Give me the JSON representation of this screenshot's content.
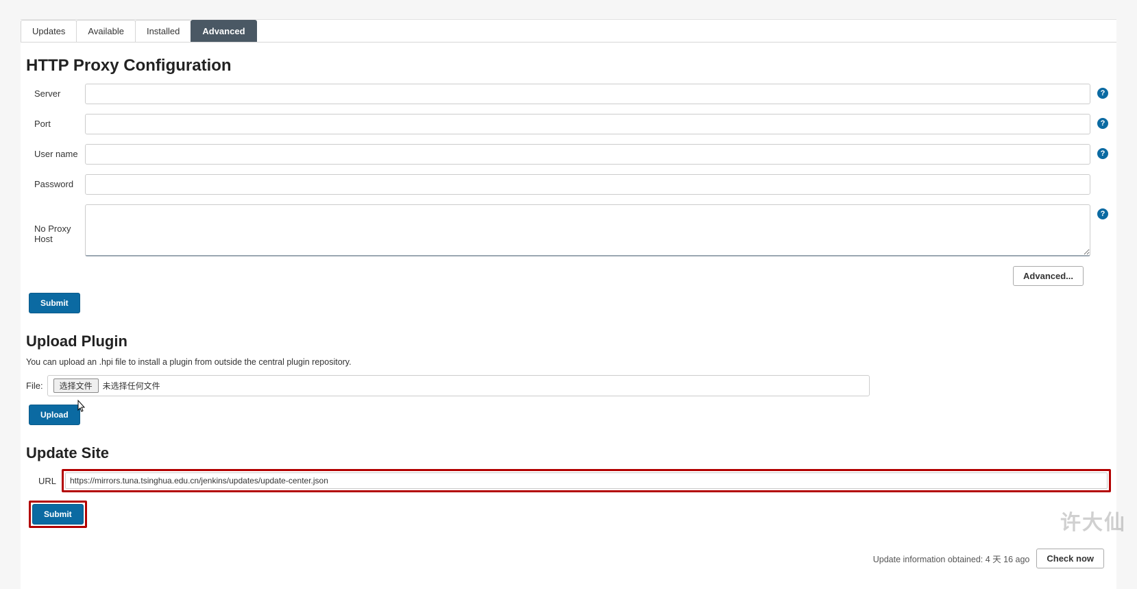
{
  "tabs": [
    {
      "label": "Updates",
      "active": false
    },
    {
      "label": "Available",
      "active": false
    },
    {
      "label": "Installed",
      "active": false
    },
    {
      "label": "Advanced",
      "active": true
    }
  ],
  "proxy": {
    "heading": "HTTP Proxy Configuration",
    "server_label": "Server",
    "server_value": "",
    "port_label": "Port",
    "port_value": "",
    "username_label": "User name",
    "username_value": "",
    "password_label": "Password",
    "password_value": "",
    "noproxy_label": "No Proxy Host",
    "noproxy_value": "",
    "advanced_button": "Advanced...",
    "submit_button": "Submit",
    "help_glyph": "?"
  },
  "upload": {
    "heading": "Upload Plugin",
    "description": "You can upload an .hpi file to install a plugin from outside the central plugin repository.",
    "file_label": "File:",
    "choose_button": "选择文件",
    "no_file_text": "未选择任何文件",
    "upload_button": "Upload"
  },
  "update_site": {
    "heading": "Update Site",
    "url_label": "URL",
    "url_value": "https://mirrors.tuna.tsinghua.edu.cn/jenkins/updates/update-center.json",
    "submit_button": "Submit"
  },
  "footer": {
    "info_text": "Update information obtained: 4 天 16 ago",
    "check_button": "Check now"
  },
  "watermark": "许大仙"
}
